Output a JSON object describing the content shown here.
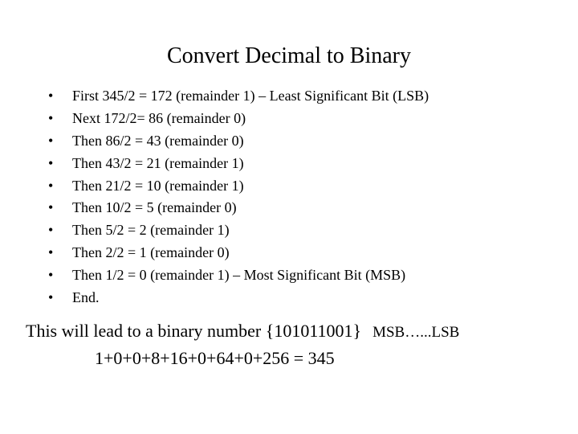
{
  "title": "Convert Decimal to Binary",
  "bullets": [
    "First 345/2 = 172 (remainder 1) – Least Significant Bit (LSB)",
    "Next 172/2= 86 (remainder 0)",
    "Then 86/2 = 43 (remainder 0)",
    "Then 43/2 = 21 (remainder 1)",
    "Then 21/2 = 10 (remainder 1)",
    "Then 10/2 = 5 (remainder 0)",
    "Then 5/2 = 2 (remainder 1)",
    "Then 2/2 = 1 (remainder 0)",
    "Then 1/2 = 0 (remainder 1) – Most Significant Bit (MSB)",
    "End."
  ],
  "closing": {
    "line1_main": "This will lead to a binary number {101011001}",
    "line1_tail": "MSB…...LSB",
    "line2": "1+0+0+8+16+0+64+0+256 = 345"
  }
}
